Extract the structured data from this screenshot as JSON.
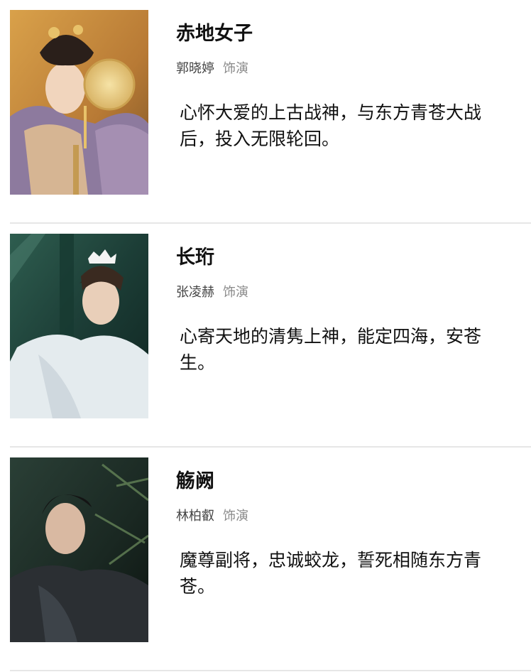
{
  "cast": [
    {
      "character": "赤地女子",
      "actor": "郭晓婷",
      "role_word": "饰演",
      "description": "心怀大爱的上古战神，与东方青苍大战后，投入无限轮回。"
    },
    {
      "character": "长珩",
      "actor": "张凌赫",
      "role_word": "饰演",
      "description": "心寄天地的清隽上神，能定四海，安苍生。"
    },
    {
      "character": "觞阙",
      "actor": "林柏叡",
      "role_word": "饰演",
      "description": "魔尊副将，忠诚蛟龙，誓死相随东方青苍。"
    }
  ],
  "colors": {
    "title": "#111111",
    "actor": "#444444",
    "role_word": "#8a8a8a",
    "divider": "#e6e6e6"
  }
}
